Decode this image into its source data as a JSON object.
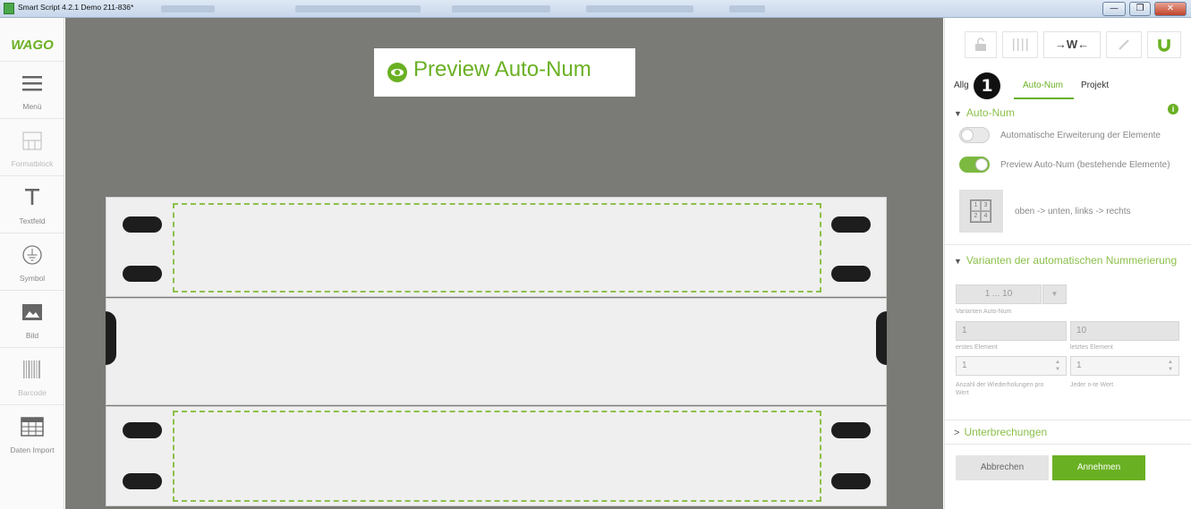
{
  "window": {
    "title": "Smart Script 4.2.1   Demo 211-836*",
    "buttons": [
      "—",
      "❐",
      "✕"
    ]
  },
  "leftbar": {
    "logo": "WAGO",
    "tools": [
      {
        "label": "Menü",
        "icon": "hamburger-icon",
        "enabled": true
      },
      {
        "label": "Formatblock",
        "icon": "format-block-icon",
        "enabled": false
      },
      {
        "label": "Textfeld",
        "icon": "text-icon",
        "enabled": true
      },
      {
        "label": "Symbol",
        "icon": "ground-symbol-icon",
        "enabled": true
      },
      {
        "label": "Bild",
        "icon": "image-icon",
        "enabled": true
      },
      {
        "label": "Barcode",
        "icon": "barcode-icon",
        "enabled": false
      },
      {
        "label": "Daten Import",
        "icon": "table-icon",
        "enabled": true
      }
    ]
  },
  "canvas": {
    "preview_label": "Preview Auto-Num"
  },
  "panel": {
    "tabs": [
      {
        "label": "Allg",
        "active": false
      },
      {
        "label": "Auto-Num",
        "active": true
      },
      {
        "label": "Projekt",
        "active": false
      }
    ],
    "marker": "1",
    "autonum": {
      "header": "Auto-Num",
      "toggle1": {
        "label": "Automatische Erweiterung der Elemente",
        "on": false
      },
      "toggle2": {
        "label": "Preview Auto-Num (bestehende Elemente)",
        "on": true
      },
      "order_label": "oben -> unten, links -> rechts",
      "order_grid": [
        "1",
        "3",
        "2",
        "4"
      ]
    },
    "variants": {
      "header": "Varianten der automatischen Nummerierung",
      "select_value": "1 ... 10",
      "select_caption": "Varianten Auto-Num",
      "first_value": "1",
      "first_caption": "erstes Element",
      "last_value": "10",
      "last_caption": "letztes Element",
      "repeat_value": "1",
      "repeat_caption_1": "Anzahl der Wiederholungen pro",
      "repeat_caption_2": "Wert",
      "nth_value": "1",
      "nth_caption": "Jeder n-te Wert"
    },
    "interruptions": {
      "header": "Unterbrechungen"
    },
    "cancel_label": "Abbrechen",
    "accept_label": "Annehmen"
  },
  "colors": {
    "accent": "#6ab023",
    "canvas_bg": "#7a7a76",
    "marker": "#111111"
  }
}
